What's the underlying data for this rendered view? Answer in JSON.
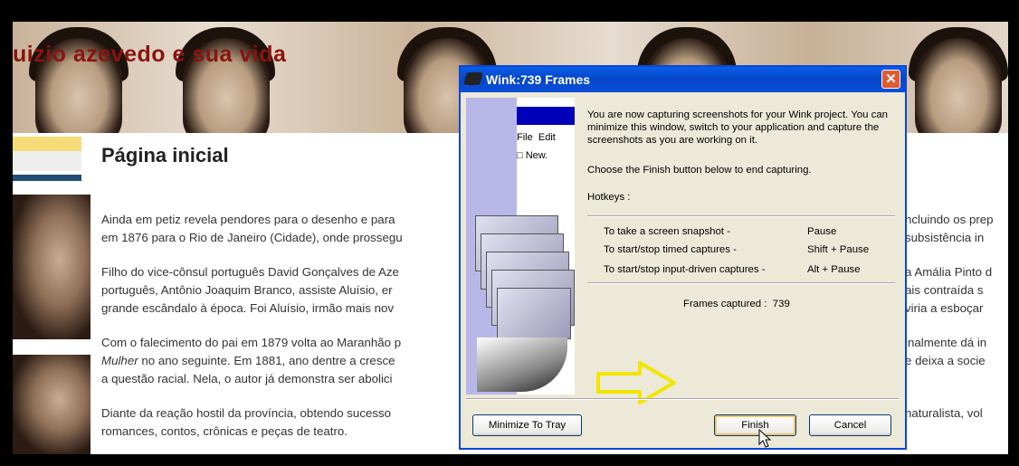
{
  "site": {
    "title": "uizio azevedo e sua vida",
    "page_heading": "Página inicial",
    "paragraphs": [
      {
        "line1": "Ainda em petiz revela pendores para o desenho e para",
        "line1_right": "ncluindo os prep",
        "line2": "em 1876 para o Rio de Janeiro (Cidade), onde prossegu",
        "line2_right": "subsistência in"
      },
      {
        "line1": "Filho do vice-cônsul português David Gonçalves de Aze",
        "line1_right": "a Amália Pinto d",
        "line2": "português, Antônio Joaquim Branco, assiste Aluísio, er",
        "line2_right": "ais contraída s",
        "line3": "grande escândalo à época. Foi Aluísio, irmão mais nov",
        "line3_right": "viria a esboçar"
      },
      {
        "line1": "Com o falecimento do pai em 1879 volta ao Maranhão p",
        "line1_right": "inalmente dá in",
        "line2_italic": "Mulher",
        "line2": " no ano seguinte. Em 1881, ano dentre a cresce",
        "line2_right": "e deixa a socie",
        "line3": "a questão racial. Nela, o autor já demonstra ser abolici"
      },
      {
        "line1": "Diante da reação hostil da província, obtendo sucesso",
        "line1_right": "naturalista, vol",
        "line2": "romances, contos, crônicas e peças de teatro."
      }
    ]
  },
  "dialog": {
    "title": "Wink:739 Frames",
    "close_symbol": "✕",
    "message": "You are now capturing screenshots for your Wink project. You can minimize this window, switch to your application and capture the screenshots as you are working on it.",
    "choose_text": "Choose the Finish button below to end capturing.",
    "hotkeys_label": "Hotkeys :",
    "hotkeys": [
      {
        "action": "To take a screen snapshot -",
        "key": "Pause"
      },
      {
        "action": "To start/stop timed captures -",
        "key": "Shift + Pause"
      },
      {
        "action": "To start/stop input-driven captures -",
        "key": "Alt + Pause"
      }
    ],
    "frames_label": "Frames captured :",
    "frames_value": "739",
    "illustration": {
      "menu_file": "File",
      "menu_edit": "Edit",
      "new_item": "New."
    },
    "buttons": {
      "minimize": "Minimize To Tray",
      "finish": "Finish",
      "cancel": "Cancel"
    }
  },
  "colors": {
    "title_red": "#8a1410",
    "xp_blue": "#0a46d8",
    "arrow_yellow": "#f2e600"
  }
}
